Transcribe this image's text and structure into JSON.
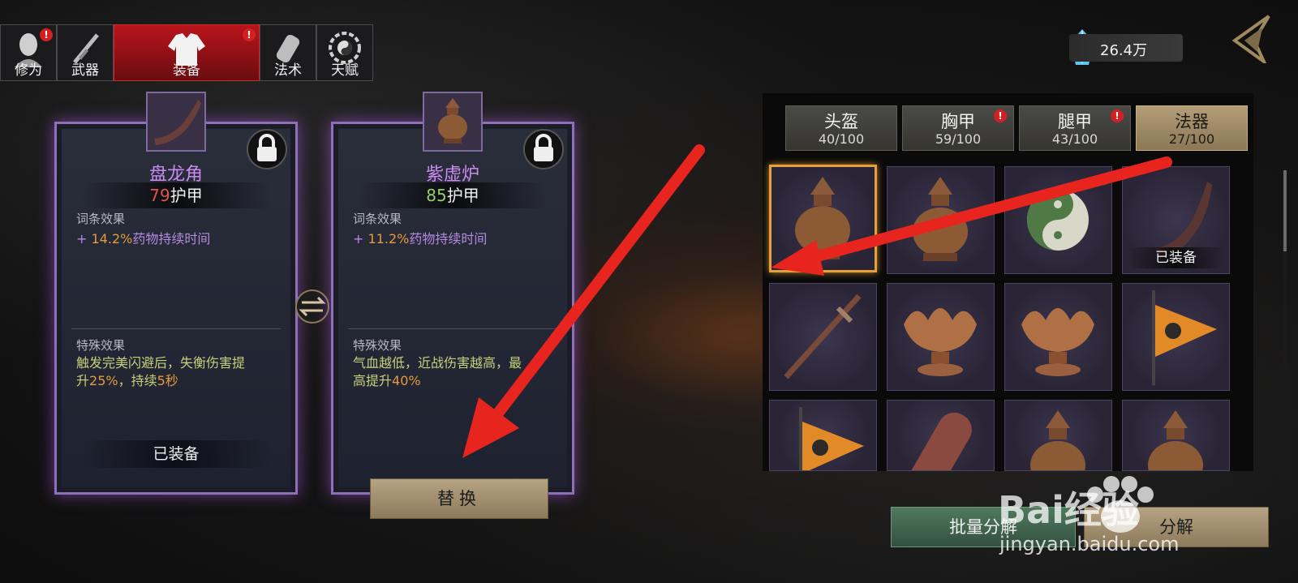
{
  "nav_tabs": [
    {
      "label": "修为",
      "badge": "!"
    },
    {
      "label": "武器",
      "badge": ""
    },
    {
      "label": "装备",
      "badge": "!"
    },
    {
      "label": "法术",
      "badge": ""
    },
    {
      "label": "天赋",
      "badge": ""
    }
  ],
  "currency": {
    "value": "26.4万",
    "icon": "crystal-icon"
  },
  "left_card": {
    "name": "盘龙角",
    "armor_value": "79",
    "armor_label": "护甲",
    "affix_title": "词条效果",
    "affix_prefix": "+ ",
    "affix_pct": "14.2%",
    "affix_text": "药物持续时间",
    "special_title": "特殊效果",
    "special_1": "触发完美闪避后，失衡伤害提",
    "special_2a": "升",
    "special_2b": "25%",
    "special_2c": "，持续",
    "special_2d": "5秒",
    "status": "已装备"
  },
  "right_card": {
    "name": "紫虚炉",
    "armor_value": "85",
    "armor_label": "护甲",
    "affix_title": "词条效果",
    "affix_prefix": "+ ",
    "affix_pct": "11.2%",
    "affix_text": "药物持续时间",
    "special_title": "特殊效果",
    "special_1": "气血越低，近战伤害越高，最",
    "special_2a": "高提升",
    "special_2b": "40%"
  },
  "swap_button": "替换",
  "categories": [
    {
      "name": "头盔",
      "count": "40/100",
      "badge": ""
    },
    {
      "name": "胸甲",
      "count": "59/100",
      "badge": "!"
    },
    {
      "name": "腿甲",
      "count": "43/100",
      "badge": "!"
    },
    {
      "name": "法器",
      "count": "27/100",
      "badge": ""
    }
  ],
  "equipped_tag": "已装备",
  "items": [
    "censer",
    "censer",
    "yin-yang",
    "horn",
    "sword",
    "lotus-bowl",
    "lotus-bowl",
    "flag",
    "flag",
    "scroll",
    "censer",
    "censer"
  ],
  "batch_decompose": "批量分解",
  "decompose": "分解",
  "watermark": {
    "brand": "Bai经验",
    "url": "jingyan.baidu.com"
  },
  "colors": {
    "accent_red": "#b8151b",
    "purple_border": "#8e6fb8",
    "gold_select": "#e8a03a"
  }
}
